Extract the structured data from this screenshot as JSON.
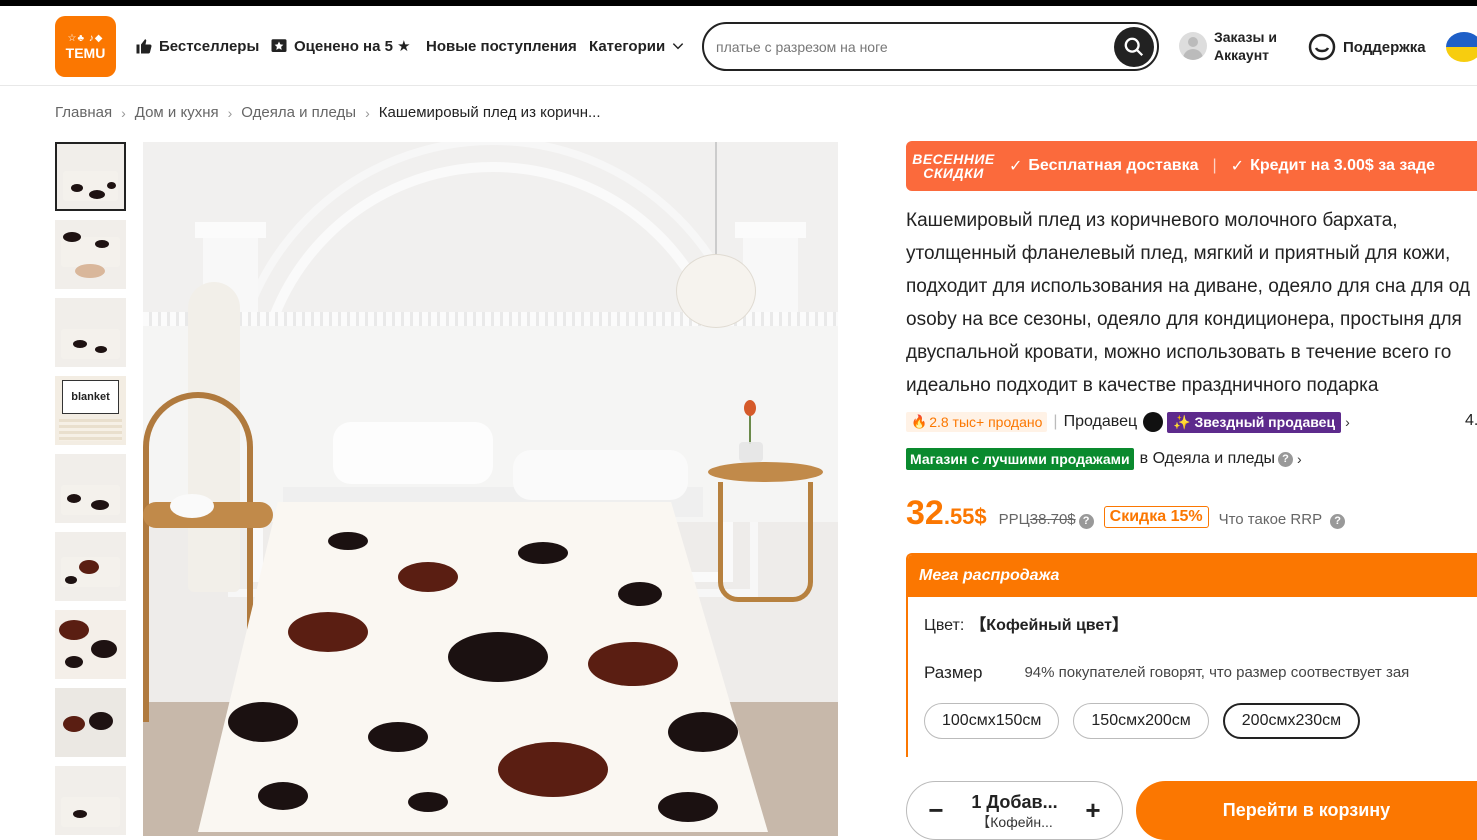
{
  "header": {
    "logo_text": "TEMU",
    "logo_top": "☆♣ ♪◆",
    "nav": [
      {
        "label": "Бестселлеры",
        "icon": "thumbs-up-icon"
      },
      {
        "label": "Оценено на 5 ★",
        "icon": "star-badge-icon"
      },
      {
        "label": "Новые поступления",
        "icon": ""
      },
      {
        "label": "Категории",
        "icon": "chevron-down-icon"
      }
    ],
    "search_placeholder": "платье с разрезом на ноге",
    "account_label": "Заказы и Аккаунт",
    "support_label": "Поддержка",
    "flag": "ukraine-flag"
  },
  "breadcrumb": [
    "Главная",
    "Дом и кухня",
    "Одеяла и пледы",
    "Кашемировый плед из коричн..."
  ],
  "thumbnails": [
    {
      "kind": "bed"
    },
    {
      "kind": "hand"
    },
    {
      "kind": "bed"
    },
    {
      "kind": "label",
      "text": "blanket"
    },
    {
      "kind": "bed"
    },
    {
      "kind": "folded"
    },
    {
      "kind": "closeup"
    },
    {
      "kind": "rolled"
    },
    {
      "kind": "bed"
    }
  ],
  "promo": {
    "label_line1": "ВЕСЕННИЕ",
    "label_line2": "СКИДКИ",
    "item1": "Бесплатная доставка",
    "item2": "Кредит на 3.00$ за заде"
  },
  "product": {
    "title_lines": [
      "Кашемировый плед из коричневого молочного бархата,",
      "утолщенный фланелевый плед, мягкий и приятный для кожи,",
      "подходит для использования на диване, одеяло для сна для од",
      "osoby на все сезоны, одеяло для кондиционера, простыня для",
      "двуспальной кровати, можно использовать в течение всего го",
      "идеально подходит в качестве праздничного подарка"
    ],
    "sold": "2.8 тыс+ продано",
    "seller_label": "Продавец",
    "star_seller": "Звездный продавец",
    "rating": "4.",
    "best_badge": "Магазин с лучшими продажами",
    "best_category": "в Одеяла и пледы",
    "price_whole": "32",
    "price_cents": ".55$",
    "rrp_label": "РРЦ",
    "rrp_value": "38.70$",
    "discount": "Скидка 15%",
    "what_rrp": "Что такое RRP"
  },
  "mega": {
    "title": "Мега распродажа",
    "color_label": "Цвет:",
    "color_value": "【Кофейный цвет】",
    "size_label": "Размер",
    "size_note": "94% покупателей говорят, что размер соотвествует зая",
    "sizes": [
      "100смх150см",
      "150смх200см",
      "200смх230см"
    ],
    "selected_size_index": 2
  },
  "cart": {
    "qty_main": "1 Добав...",
    "qty_sub": "【Кофейн...",
    "checkout": "Перейти в корзину"
  },
  "colors": {
    "accent": "#fb7701",
    "promo": "#fb6a3c",
    "star_seller": "#5d2a8c",
    "best_badge": "#0a8a2e"
  }
}
